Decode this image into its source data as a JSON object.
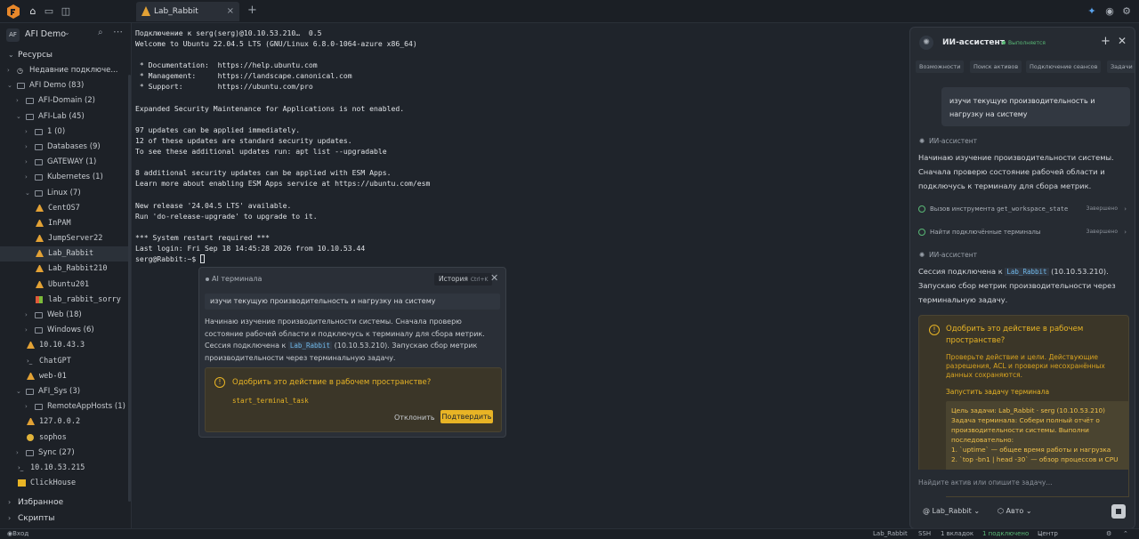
{
  "topbar": {
    "tab_label": "Lab_Rabbit",
    "tab_close": "×",
    "add_tab": "+"
  },
  "sidebar": {
    "workspace_avatar": "AF",
    "workspace_name": "AFI Demo",
    "resources_label": "Ресурсы",
    "tree": [
      {
        "label": "Недавние подключе...",
        "indent": 0,
        "arrow": "›",
        "icon": "clock-icon"
      },
      {
        "label": "AFI Demo (83)",
        "indent": 0,
        "arrow": "⌄",
        "icon": "folder-icon"
      },
      {
        "label": "AFI-Domain (2)",
        "indent": 1,
        "arrow": "›",
        "icon": "folder-icon"
      },
      {
        "label": "AFI-Lab (45)",
        "indent": 1,
        "arrow": "⌄",
        "icon": "folder-icon"
      },
      {
        "label": "1 (0)",
        "indent": 2,
        "arrow": "›",
        "icon": "folder-icon"
      },
      {
        "label": "Databases (9)",
        "indent": 2,
        "arrow": "›",
        "icon": "folder-icon"
      },
      {
        "label": "GATEWAY (1)",
        "indent": 2,
        "arrow": "›",
        "icon": "folder-icon"
      },
      {
        "label": "Kubernetes (1)",
        "indent": 2,
        "arrow": "›",
        "icon": "folder-icon"
      },
      {
        "label": "Linux (7)",
        "indent": 2,
        "arrow": "⌄",
        "icon": "folder-icon"
      },
      {
        "label": "CentOS7",
        "indent": 3,
        "arrow": "",
        "icon": "linux-icon",
        "mono": true
      },
      {
        "label": "InPAM",
        "indent": 3,
        "arrow": "",
        "icon": "linux-icon",
        "mono": true
      },
      {
        "label": "JumpServer22",
        "indent": 3,
        "arrow": "",
        "icon": "linux-icon",
        "mono": true
      },
      {
        "label": "Lab_Rabbit",
        "indent": 3,
        "arrow": "",
        "icon": "linux-icon",
        "mono": true,
        "selected": true
      },
      {
        "label": "Lab_Rabbit210",
        "indent": 3,
        "arrow": "",
        "icon": "linux-icon",
        "mono": true
      },
      {
        "label": "Ubuntu201",
        "indent": 3,
        "arrow": "",
        "icon": "linux-icon",
        "mono": true
      },
      {
        "label": "lab_rabbit_sorry",
        "indent": 3,
        "arrow": "",
        "icon": "windows-icon",
        "mono": true
      },
      {
        "label": "Web (18)",
        "indent": 2,
        "arrow": "›",
        "icon": "folder-icon"
      },
      {
        "label": "Windows (6)",
        "indent": 2,
        "arrow": "›",
        "icon": "folder-icon"
      },
      {
        "label": "10.10.43.3",
        "indent": 2,
        "arrow": "",
        "icon": "linux-icon",
        "mono": true
      },
      {
        "label": "ChatGPT",
        "indent": 2,
        "arrow": "",
        "icon": "terminal-icon",
        "mono": true
      },
      {
        "label": "web-01",
        "indent": 2,
        "arrow": "",
        "icon": "linux-icon",
        "mono": true
      },
      {
        "label": "AFI_Sys (3)",
        "indent": 1,
        "arrow": "⌄",
        "icon": "folder-icon"
      },
      {
        "label": "RemoteAppHosts (1)",
        "indent": 2,
        "arrow": "›",
        "icon": "folder-icon"
      },
      {
        "label": "127.0.0.2",
        "indent": 2,
        "arrow": "",
        "icon": "linux-icon",
        "mono": true
      },
      {
        "label": "sophos",
        "indent": 2,
        "arrow": "",
        "icon": "chrome-icon",
        "mono": true
      },
      {
        "label": "Sync (27)",
        "indent": 1,
        "arrow": "›",
        "icon": "folder-icon"
      },
      {
        "label": "10.10.53.215",
        "indent": 1,
        "arrow": "",
        "icon": "terminal-icon",
        "mono": true
      },
      {
        "label": "ClickHouse",
        "indent": 1,
        "arrow": "",
        "icon": "db-icon",
        "mono": true
      }
    ],
    "favorites_label": "Избранное",
    "scripts_label": "Скрипты"
  },
  "terminal": {
    "lines": [
      "Подключение к serg(serg)@10.10.53.210…  0.5",
      "Welcome to Ubuntu 22.04.5 LTS (GNU/Linux 6.8.0-1064-azure x86_64)",
      "",
      " * Documentation:  https://help.ubuntu.com",
      " * Management:     https://landscape.canonical.com",
      " * Support:        https://ubuntu.com/pro",
      "",
      "Expanded Security Maintenance for Applications is not enabled.",
      "",
      "97 updates can be applied immediately.",
      "12 of these updates are standard security updates.",
      "To see these additional updates run: apt list --upgradable",
      "",
      "8 additional security updates can be applied with ESM Apps.",
      "Learn more about enabling ESM Apps service at https://ubuntu.com/esm",
      "",
      "New release '24.04.5 LTS' available.",
      "Run 'do-release-upgrade' to upgrade to it.",
      "",
      "*** System restart required ***",
      "Last login: Fri Sep 18 14:45:28 2026 from 10.10.53.44"
    ],
    "prompt": "serg@Rabbit:~$ "
  },
  "ai_popup": {
    "title": "AI терминала",
    "history_label": "История",
    "history_shortcut": "Ctrl+K",
    "close": "✕",
    "query": "изучи текущую производительность и нагрузку на систему",
    "text1": "Начинаю изучение производительности системы. Сначала проверю состояние рабочей области и подключусь к терминалу для сбора метрик.",
    "text2_a": "Сессия подключена к ",
    "text2_chip": "Lab_Rabbit",
    "text2_b": " (10.10.53.210). Запускаю сбор метрик производительности через терминальную задачу.",
    "approve_question": "Одобрить это действие в рабочем пространстве?",
    "task": "start_terminal_task",
    "reject": "Отклонить",
    "approve": "Подтвердить"
  },
  "assistant": {
    "name": "ИИ-ассистент",
    "status": "Выполняется",
    "tabs": [
      "Возможности",
      "Поиск активов",
      "Подключение сеансов",
      "Задачи"
    ],
    "user_message": "изучи текущую производительность и нагрузку на систему",
    "bot_label": "ИИ-ассистент",
    "msg1": "Начинаю изучение производительности системы. Сначала проверю состояние рабочей области и подключусь к терминалу для сбора метрик.",
    "tool1_prefix": "Вызов инструмента ",
    "tool1_code": "get_workspace_state",
    "tool1_status": "Завершено",
    "tool2": "Найти подключённые терминалы",
    "tool2_status": "Завершено",
    "msg2_a": "Сессия подключена к ",
    "msg2_chip": "Lab_Rabbit",
    "msg2_b": " (10.10.53.210). Запускаю сбор метрик производительности через терминальную задачу.",
    "approve_question": "Одобрить это действие в рабочем пространстве?",
    "approve_desc": "Проверьте действие и цели. Действующие разрешения, ACL и проверки несохранённых данных сохраняются.",
    "approve_link": "Запустить задачу терминала",
    "task_lines": [
      "Цель задачи: Lab_Rabbit · serg (10.10.53.210)",
      "Задача терминала: Собери полный отчёт о производительности системы. Выполни последовательно:",
      "1. `uptime` — общее время работы и нагрузка",
      "2. `top -bn1 | head -30` — обзор процессов и CPU"
    ],
    "input_placeholder": "Найдите актив или опишите задачу...",
    "target": "Lab_Rabbit",
    "mode": "Авто"
  },
  "statusbar": {
    "user": "Вход выполнен: Administrator",
    "session": "Lab_Rabbit",
    "protocol": "SSH",
    "tabs": "1 вкладок",
    "connected": "1 подключено",
    "transfer": "Центр передачи"
  }
}
